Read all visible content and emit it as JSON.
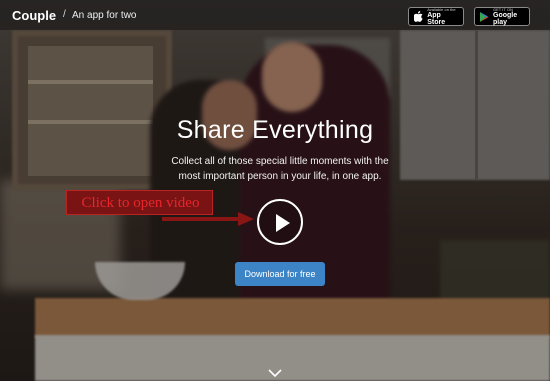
{
  "header": {
    "brand": "Couple",
    "separator": "/",
    "tagline": "An app for two",
    "app_store": {
      "small": "Available on the",
      "big": "App Store",
      "icon": "apple-icon"
    },
    "google_play": {
      "small": "GET IT ON",
      "big": "Google play",
      "icon": "play-store-icon"
    }
  },
  "hero": {
    "title": "Share Everything",
    "subtitle": "Collect all of those special little moments with the most important person in your life, in one app.",
    "play_icon": "play-icon",
    "annotation": "Click to open video",
    "cta": "Download for free",
    "scroll_icon": "chevron-down-icon"
  },
  "colors": {
    "cta": "#3d84c6",
    "annotation_text": "#e8252a",
    "annotation_bg": "#7a1414"
  }
}
